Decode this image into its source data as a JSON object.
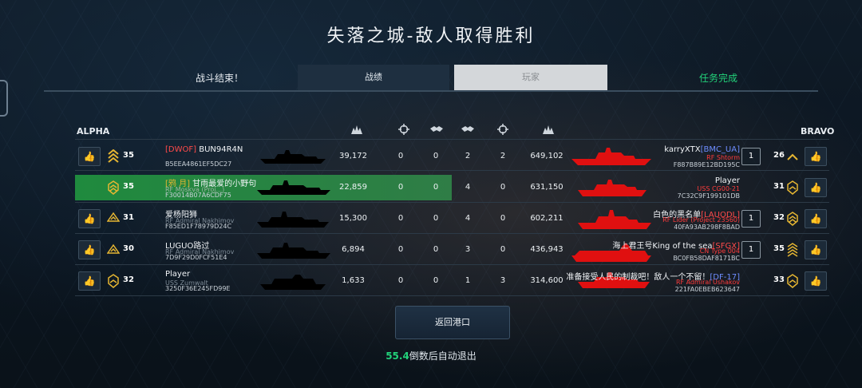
{
  "title": "失落之城-敌人取得胜利",
  "tabs": {
    "battle_end": "战斗结束！",
    "stats": "战绩",
    "players": "玩家",
    "mission": "任务完成"
  },
  "teams": {
    "alpha": "ALPHA",
    "bravo": "BRAVO"
  },
  "column_icons": [
    "damage-icon",
    "kills-icon",
    "assists-icon",
    "assists-icon",
    "kills-icon",
    "damage-icon"
  ],
  "colors": {
    "win_highlight": "#1f8a3e",
    "enemy_ship": "#e01010",
    "clan_tag": "#ff4a4a",
    "mission_green": "#22d27a"
  },
  "rows": [
    {
      "left": {
        "clan": "[DWOF]",
        "name": "BUN94R4N",
        "ship": "",
        "id": "B5EEA4861EF5DC27",
        "level": "35",
        "damage": "39,172",
        "kills": "0",
        "assists": "0"
      },
      "right": {
        "assists": "2",
        "kills": "2",
        "damage": "649,102",
        "name": "karryXTX",
        "clan": "[BMC_UA]",
        "ship": "RF Shtorm",
        "id": "F887B89E12BD195C",
        "squad": "1",
        "level": "26"
      }
    },
    {
      "left": {
        "clan": "[鸦 月]",
        "name": "甘雨最爱的小野句",
        "ship": "RF Moskva (Proj...)",
        "id": "F30014B07A6CDF75",
        "level": "35",
        "damage": "22,859",
        "kills": "0",
        "assists": "0",
        "self": true
      },
      "right": {
        "assists": "4",
        "kills": "0",
        "damage": "631,150",
        "name": "Player",
        "clan": "",
        "ship": "USS CG00-21",
        "id": "7C32C9F199101DB",
        "squad": "",
        "level": "31"
      }
    },
    {
      "left": {
        "clan": "",
        "name": "爱杨阳狮",
        "ship": "RF Admiral Nakhimov",
        "id": "F85ED1F78979D24C",
        "level": "31",
        "damage": "15,300",
        "kills": "0",
        "assists": "0"
      },
      "right": {
        "assists": "4",
        "kills": "0",
        "damage": "602,211",
        "name": "白色的黑名单",
        "clan": "[LAUODL]",
        "ship": "RF Lider (Project 23560)",
        "id": "40FA93AB298F8BAD",
        "squad": "1",
        "level": "32"
      }
    },
    {
      "left": {
        "clan": "",
        "name": "LUGUO路过",
        "ship": "RF Admiral Nakhimov",
        "id": "7D9F29D0FCF51E4",
        "level": "30",
        "damage": "6,894",
        "kills": "0",
        "assists": "0"
      },
      "right": {
        "assists": "3",
        "kills": "0",
        "damage": "436,943",
        "name": "海上君王号King of the sea",
        "clan": "[SFGX]",
        "ship": "CN Type 004",
        "id": "BC0FB58DAF8171BC",
        "squad": "1",
        "level": "35"
      }
    },
    {
      "left": {
        "clan": "",
        "name": "Player",
        "ship": "USS Zumwalt",
        "id": "3250F36E245FD99E",
        "level": "32",
        "damage": "1,633",
        "kills": "0",
        "assists": "0"
      },
      "right": {
        "assists": "1",
        "kills": "3",
        "damage": "314,600",
        "name": "准备接受人民的制裁吧！敌人一个不留！",
        "clan": "[DF-17]",
        "ship": "RF Admiral Ushakov",
        "id": "221FA0EBEB623647",
        "squad": "",
        "level": "33"
      }
    }
  ],
  "return_button": "返回港口",
  "countdown": {
    "seconds": "55.4",
    "suffix": "倒数后自动退出"
  }
}
